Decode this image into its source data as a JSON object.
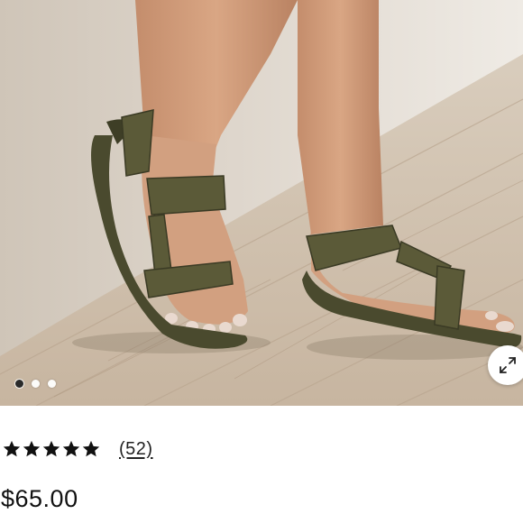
{
  "product": {
    "rating": 5,
    "rating_max": 5,
    "review_count": "(52)",
    "price": "$65.00"
  },
  "carousel": {
    "slide_count": 3,
    "active_index": 0
  },
  "icons": {
    "expand": "expand-arrows-icon",
    "star": "star-icon"
  },
  "colors": {
    "text": "#111111",
    "sandal": "#4a4a2e",
    "background": "#ffffff"
  }
}
